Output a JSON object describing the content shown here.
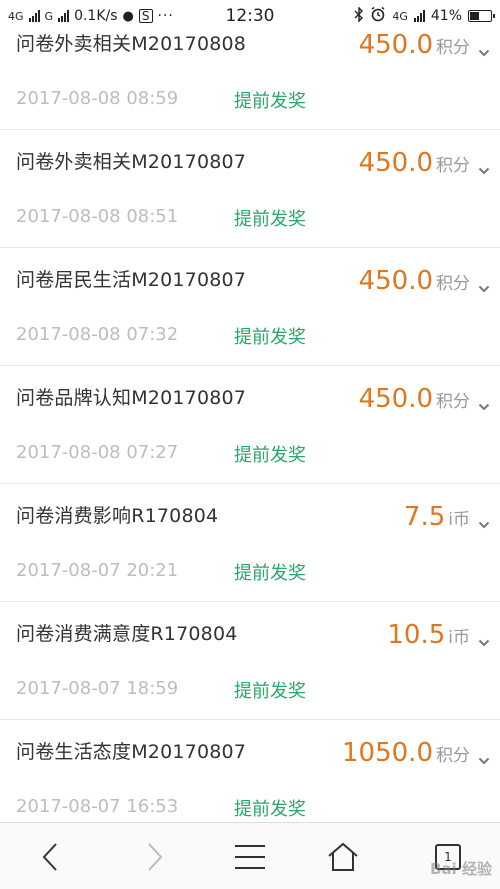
{
  "status_bar": {
    "network_1": "4G",
    "network_2": "G",
    "speed": "0.1K/s",
    "time": "12:30",
    "network_right": "4G",
    "battery": "41%"
  },
  "colors": {
    "amount": "#e0761e",
    "prize": "#2aa76a",
    "date": "#bdbdbd",
    "title": "#333333"
  },
  "records": [
    {
      "title": "问卷外卖相关M20170808",
      "amount": "450.0",
      "unit": "积分",
      "time": "2017-08-08 08:59",
      "action": "提前发奖"
    },
    {
      "title": "问卷外卖相关M20170807",
      "amount": "450.0",
      "unit": "积分",
      "time": "2017-08-08 08:51",
      "action": "提前发奖"
    },
    {
      "title": "问卷居民生活M20170807",
      "amount": "450.0",
      "unit": "积分",
      "time": "2017-08-08 07:32",
      "action": "提前发奖"
    },
    {
      "title": "问卷品牌认知M20170807",
      "amount": "450.0",
      "unit": "积分",
      "time": "2017-08-08 07:27",
      "action": "提前发奖"
    },
    {
      "title": "问卷消费影响R170804",
      "amount": "7.5",
      "unit": "i币",
      "time": "2017-08-07 20:21",
      "action": "提前发奖"
    },
    {
      "title": "问卷消费满意度R170804",
      "amount": "10.5",
      "unit": "i币",
      "time": "2017-08-07 18:59",
      "action": "提前发奖"
    },
    {
      "title": "问卷生活态度M20170807",
      "amount": "1050.0",
      "unit": "积分",
      "time": "2017-08-07 16:53",
      "action": "提前发奖"
    }
  ],
  "bottom_nav": {
    "icons": [
      "back-icon",
      "forward-icon",
      "menu-icon",
      "home-icon",
      "tabs-icon"
    ],
    "tab_count": "1"
  },
  "watermark": "Bai 经验"
}
